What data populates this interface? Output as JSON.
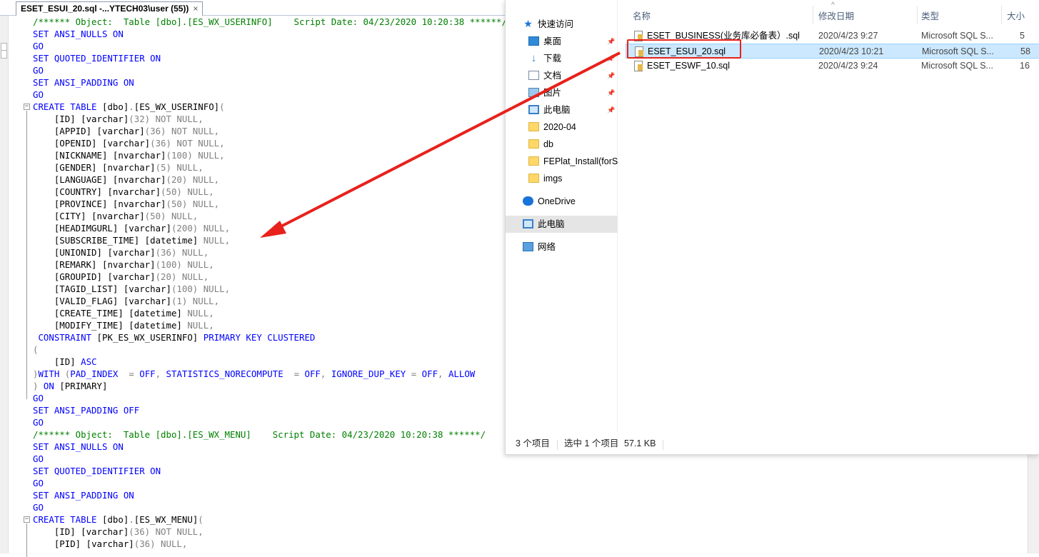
{
  "editor": {
    "tab_title": "ESET_ESUI_20.sql -...YTECH03\\user (55))",
    "tab_close": "×",
    "lines": [
      [
        {
          "t": "/****** Object:  Table [dbo].[ES_WX_USERINFO]    Script Date: 04/23/2020 10:20:38 ******/",
          "c": "c"
        }
      ],
      [
        {
          "t": "SET ANSI_NULLS ",
          "c": "k"
        },
        {
          "t": "ON",
          "c": "k"
        }
      ],
      [
        {
          "t": "GO",
          "c": "k"
        }
      ],
      [
        {
          "t": "SET QUOTED_IDENTIFIER ",
          "c": "k"
        },
        {
          "t": "ON",
          "c": "k"
        }
      ],
      [
        {
          "t": "GO",
          "c": "k"
        }
      ],
      [
        {
          "t": "SET ANSI_PADDING ",
          "c": "k"
        },
        {
          "t": "ON",
          "c": "k"
        }
      ],
      [
        {
          "t": "GO",
          "c": "k"
        }
      ],
      [
        {
          "t": "CREATE TABLE ",
          "c": "k"
        },
        {
          "t": "[dbo]",
          "c": "n"
        },
        {
          "t": ".",
          "c": "g"
        },
        {
          "t": "[ES_WX_USERINFO]",
          "c": "n"
        },
        {
          "t": "(",
          "c": "g"
        }
      ],
      [
        {
          "t": "    [ID] ",
          "c": "n"
        },
        {
          "t": "[varchar]",
          "c": "n"
        },
        {
          "t": "(32) NOT NULL,",
          "c": "g"
        }
      ],
      [
        {
          "t": "    [APPID] ",
          "c": "n"
        },
        {
          "t": "[varchar]",
          "c": "n"
        },
        {
          "t": "(36) NOT NULL,",
          "c": "g"
        }
      ],
      [
        {
          "t": "    [OPENID] ",
          "c": "n"
        },
        {
          "t": "[varchar]",
          "c": "n"
        },
        {
          "t": "(36) NOT NULL,",
          "c": "g"
        }
      ],
      [
        {
          "t": "    [NICKNAME] ",
          "c": "n"
        },
        {
          "t": "[nvarchar]",
          "c": "n"
        },
        {
          "t": "(100) NULL,",
          "c": "g"
        }
      ],
      [
        {
          "t": "    [GENDER] ",
          "c": "n"
        },
        {
          "t": "[nvarchar]",
          "c": "n"
        },
        {
          "t": "(5) NULL,",
          "c": "g"
        }
      ],
      [
        {
          "t": "    [LANGUAGE] ",
          "c": "n"
        },
        {
          "t": "[nvarchar]",
          "c": "n"
        },
        {
          "t": "(20) NULL,",
          "c": "g"
        }
      ],
      [
        {
          "t": "    [COUNTRY] ",
          "c": "n"
        },
        {
          "t": "[nvarchar]",
          "c": "n"
        },
        {
          "t": "(50) NULL,",
          "c": "g"
        }
      ],
      [
        {
          "t": "    [PROVINCE] ",
          "c": "n"
        },
        {
          "t": "[nvarchar]",
          "c": "n"
        },
        {
          "t": "(50) NULL,",
          "c": "g"
        }
      ],
      [
        {
          "t": "    [CITY] ",
          "c": "n"
        },
        {
          "t": "[nvarchar]",
          "c": "n"
        },
        {
          "t": "(50) NULL,",
          "c": "g"
        }
      ],
      [
        {
          "t": "    [HEADIMGURL] ",
          "c": "n"
        },
        {
          "t": "[varchar]",
          "c": "n"
        },
        {
          "t": "(200) NULL,",
          "c": "g"
        }
      ],
      [
        {
          "t": "    [SUBSCRIBE_TIME] ",
          "c": "n"
        },
        {
          "t": "[datetime]",
          "c": "n"
        },
        {
          "t": " NULL,",
          "c": "g"
        }
      ],
      [
        {
          "t": "    [UNIONID] ",
          "c": "n"
        },
        {
          "t": "[varchar]",
          "c": "n"
        },
        {
          "t": "(36) NULL,",
          "c": "g"
        }
      ],
      [
        {
          "t": "    [REMARK] ",
          "c": "n"
        },
        {
          "t": "[nvarchar]",
          "c": "n"
        },
        {
          "t": "(100) NULL,",
          "c": "g"
        }
      ],
      [
        {
          "t": "    [GROUPID] ",
          "c": "n"
        },
        {
          "t": "[varchar]",
          "c": "n"
        },
        {
          "t": "(20) NULL,",
          "c": "g"
        }
      ],
      [
        {
          "t": "    [TAGID_LIST] ",
          "c": "n"
        },
        {
          "t": "[varchar]",
          "c": "n"
        },
        {
          "t": "(100) NULL,",
          "c": "g"
        }
      ],
      [
        {
          "t": "    [VALID_FLAG] ",
          "c": "n"
        },
        {
          "t": "[varchar]",
          "c": "n"
        },
        {
          "t": "(1) NULL,",
          "c": "g"
        }
      ],
      [
        {
          "t": "    [CREATE_TIME] ",
          "c": "n"
        },
        {
          "t": "[datetime]",
          "c": "n"
        },
        {
          "t": " NULL,",
          "c": "g"
        }
      ],
      [
        {
          "t": "    [MODIFY_TIME] ",
          "c": "n"
        },
        {
          "t": "[datetime]",
          "c": "n"
        },
        {
          "t": " NULL,",
          "c": "g"
        }
      ],
      [
        {
          "t": " CONSTRAINT ",
          "c": "k"
        },
        {
          "t": "[PK_ES_WX_USERINFO]",
          "c": "n"
        },
        {
          "t": " PRIMARY KEY CLUSTERED",
          "c": "k"
        }
      ],
      [
        {
          "t": "(",
          "c": "g"
        }
      ],
      [
        {
          "t": "    [ID] ",
          "c": "n"
        },
        {
          "t": "ASC",
          "c": "k"
        }
      ],
      [
        {
          "t": ")",
          "c": "g"
        },
        {
          "t": "WITH ",
          "c": "k"
        },
        {
          "t": "(",
          "c": "g"
        },
        {
          "t": "PAD_INDEX  ",
          "c": "k"
        },
        {
          "t": "= ",
          "c": "g"
        },
        {
          "t": "OFF",
          "c": "k"
        },
        {
          "t": ", ",
          "c": "g"
        },
        {
          "t": "STATISTICS_NORECOMPUTE  ",
          "c": "k"
        },
        {
          "t": "= ",
          "c": "g"
        },
        {
          "t": "OFF",
          "c": "k"
        },
        {
          "t": ", ",
          "c": "g"
        },
        {
          "t": "IGNORE_DUP_KEY ",
          "c": "k"
        },
        {
          "t": "= ",
          "c": "g"
        },
        {
          "t": "OFF",
          "c": "k"
        },
        {
          "t": ", ",
          "c": "g"
        },
        {
          "t": "ALLOW",
          "c": "k"
        }
      ],
      [
        {
          "t": ") ",
          "c": "g"
        },
        {
          "t": "ON ",
          "c": "k"
        },
        {
          "t": "[PRIMARY]",
          "c": "n"
        }
      ],
      [
        {
          "t": "GO",
          "c": "k"
        }
      ],
      [
        {
          "t": "SET ANSI_PADDING ",
          "c": "k"
        },
        {
          "t": "OFF",
          "c": "k"
        }
      ],
      [
        {
          "t": "GO",
          "c": "k"
        }
      ],
      [
        {
          "t": "/****** Object:  Table [dbo].[ES_WX_MENU]    Script Date: 04/23/2020 10:20:38 ******/",
          "c": "c"
        }
      ],
      [
        {
          "t": "SET ANSI_NULLS ",
          "c": "k"
        },
        {
          "t": "ON",
          "c": "k"
        }
      ],
      [
        {
          "t": "GO",
          "c": "k"
        }
      ],
      [
        {
          "t": "SET QUOTED_IDENTIFIER ",
          "c": "k"
        },
        {
          "t": "ON",
          "c": "k"
        }
      ],
      [
        {
          "t": "GO",
          "c": "k"
        }
      ],
      [
        {
          "t": "SET ANSI_PADDING ",
          "c": "k"
        },
        {
          "t": "ON",
          "c": "k"
        }
      ],
      [
        {
          "t": "GO",
          "c": "k"
        }
      ],
      [
        {
          "t": "CREATE TABLE ",
          "c": "k"
        },
        {
          "t": "[dbo]",
          "c": "n"
        },
        {
          "t": ".",
          "c": "g"
        },
        {
          "t": "[ES_WX_MENU]",
          "c": "n"
        },
        {
          "t": "(",
          "c": "g"
        }
      ],
      [
        {
          "t": "    [ID] ",
          "c": "n"
        },
        {
          "t": "[varchar]",
          "c": "n"
        },
        {
          "t": "(36) NOT NULL,",
          "c": "g"
        }
      ],
      [
        {
          "t": "    [PID] ",
          "c": "n"
        },
        {
          "t": "[varchar]",
          "c": "n"
        },
        {
          "t": "(36) NULL,",
          "c": "g"
        }
      ]
    ]
  },
  "explorer": {
    "nav": [
      {
        "label": "快速访问",
        "icon": "quick-access-icon",
        "pinned": false
      },
      {
        "label": "桌面",
        "icon": "desktop-icon",
        "pinned": true
      },
      {
        "label": "下载",
        "icon": "download-icon",
        "pinned": true
      },
      {
        "label": "文档",
        "icon": "documents-icon",
        "pinned": true
      },
      {
        "label": "图片",
        "icon": "pictures-icon",
        "pinned": true
      },
      {
        "label": "此电脑",
        "icon": "this-pc-icon",
        "pinned": true
      },
      {
        "label": "2020-04",
        "icon": "folder-icon",
        "pinned": false
      },
      {
        "label": "db",
        "icon": "folder-icon",
        "pinned": false
      },
      {
        "label": "FEPlat_Install(forS(",
        "icon": "folder-icon",
        "pinned": false
      },
      {
        "label": "imgs",
        "icon": "folder-icon",
        "pinned": false
      },
      {
        "label": "OneDrive",
        "icon": "onedrive-icon",
        "pinned": false
      },
      {
        "label": "此电脑",
        "icon": "this-pc-icon",
        "pinned": false
      },
      {
        "label": "网络",
        "icon": "network-icon",
        "pinned": false
      }
    ],
    "columns": {
      "name": "名称",
      "modified": "修改日期",
      "type": "类型",
      "size": "大小"
    },
    "files": [
      {
        "name": "ESET_BUSINESS(业务库必备表）.sql",
        "modified": "2020/4/23 9:27",
        "type": "Microsoft SQL S...",
        "size": "5"
      },
      {
        "name": "ESET_ESUI_20.sql",
        "modified": "2020/4/23 10:21",
        "type": "Microsoft SQL S...",
        "size": "58"
      },
      {
        "name": "ESET_ESWF_10.sql",
        "modified": "2020/4/23 9:24",
        "type": "Microsoft SQL S...",
        "size": "16"
      }
    ],
    "status": {
      "count": "3 个项目",
      "selected": "选中 1 个项目",
      "size": "57.1 KB"
    }
  },
  "colors": {
    "annotation": "#e8211c",
    "selection": "#cce8ff",
    "keyword": "#0000ff",
    "comment": "#008000"
  }
}
